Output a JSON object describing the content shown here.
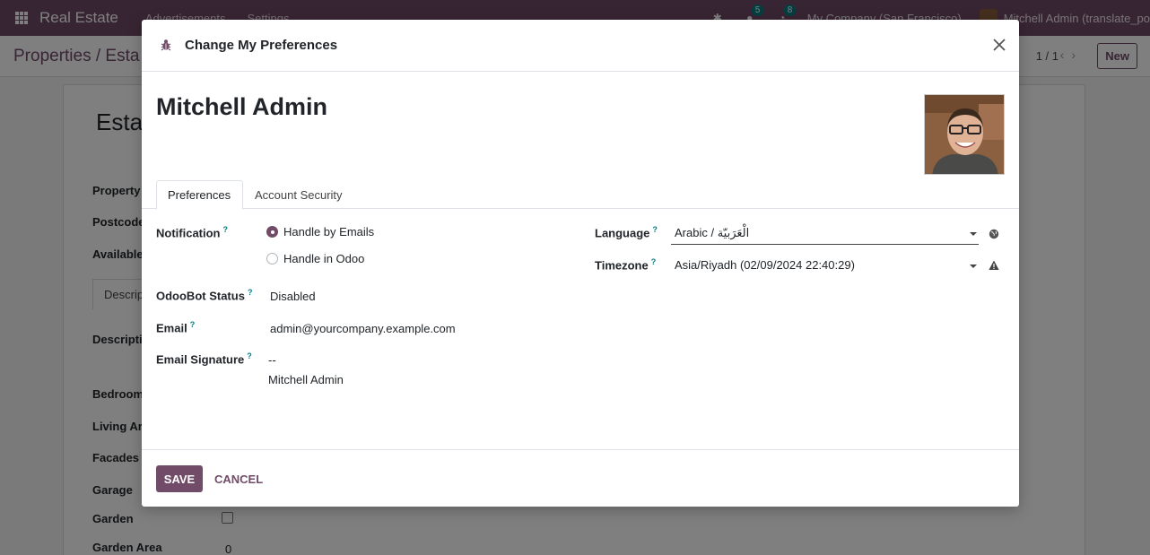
{
  "navbar": {
    "app_name": "Real Estate",
    "menus": [
      "Advertisements",
      "Settings"
    ],
    "messages_count": "5",
    "activities_count": "8",
    "company": "My Company (San Francisco)",
    "user": "Mitchell Admin (translate_po"
  },
  "control_panel": {
    "breadcrumb": "Properties / Esta",
    "pager": "1 / 1",
    "new_label": "New"
  },
  "background_form": {
    "title": "Esta",
    "labels": {
      "property": "Property",
      "postcode": "Postcode",
      "available": "Available",
      "tab": "Descrip",
      "description": "Descripti",
      "bedrooms": "Bedroom",
      "living_area": "Living Are",
      "facades": "Facades",
      "garage": "Garage",
      "garden": "Garden",
      "garden_area": "Garden Area"
    },
    "garden_area_value": "0"
  },
  "modal": {
    "title": "Change My Preferences",
    "user_name": "Mitchell Admin",
    "tabs": [
      "Preferences",
      "Account Security"
    ],
    "fields": {
      "notification": {
        "label": "Notification",
        "options": [
          "Handle by Emails",
          "Handle in Odoo"
        ],
        "selected": "Handle by Emails"
      },
      "odoobot_status": {
        "label": "OdooBot Status",
        "value": "Disabled"
      },
      "email": {
        "label": "Email",
        "value": "admin@yourcompany.example.com"
      },
      "email_signature": {
        "label": "Email Signature",
        "line1": "--",
        "line2": "Mitchell Admin"
      },
      "language": {
        "label": "Language",
        "value": "Arabic / الْعَرَبيّة"
      },
      "timezone": {
        "label": "Timezone",
        "value": "Asia/Riyadh (02/09/2024 22:40:29)"
      }
    },
    "footer": {
      "save_label": "SAVE",
      "cancel_label": "CANCEL"
    }
  },
  "colors": {
    "brand": "#714B67",
    "help_mark": "#017e84",
    "backdrop": "rgba(0,0,0,0.5)"
  }
}
